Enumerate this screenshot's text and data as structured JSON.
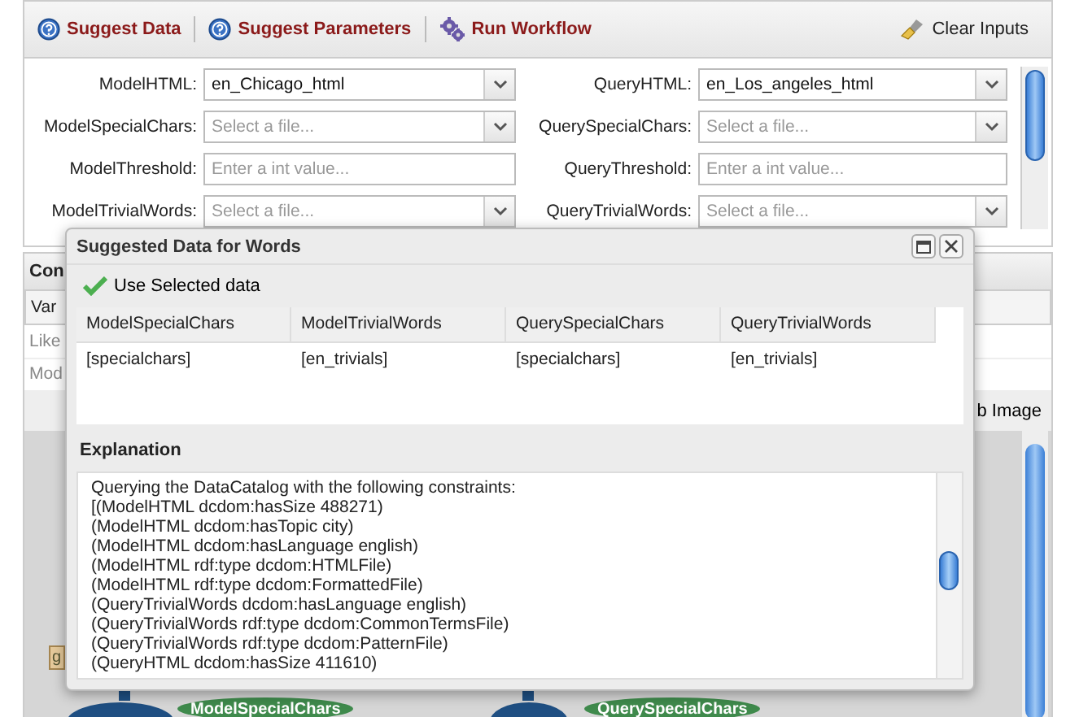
{
  "toolbar": {
    "buttons": [
      {
        "label": "Suggest Data",
        "kind": "help"
      },
      {
        "label": "Suggest Parameters",
        "kind": "help"
      },
      {
        "label": "Run Workflow",
        "kind": "gears"
      }
    ],
    "clear": "Clear Inputs"
  },
  "form": {
    "fields": [
      {
        "label": "ModelHTML:",
        "kind": "select",
        "value": "en_Chicago_html"
      },
      {
        "label": "QueryHTML:",
        "kind": "select",
        "value": "en_Los_angeles_html"
      },
      {
        "label": "ModelSpecialChars:",
        "kind": "select",
        "placeholder": "Select a file..."
      },
      {
        "label": "QuerySpecialChars:",
        "kind": "select",
        "placeholder": "Select a file..."
      },
      {
        "label": "ModelThreshold:",
        "kind": "text",
        "placeholder": "Enter a int value..."
      },
      {
        "label": "QueryThreshold:",
        "kind": "text",
        "placeholder": "Enter a int value..."
      },
      {
        "label": "ModelTrivialWords:",
        "kind": "select",
        "placeholder": "Select a file..."
      },
      {
        "label": "QueryTrivialWords:",
        "kind": "select",
        "placeholder": "Select a file..."
      }
    ]
  },
  "constraints_panel": {
    "title": "Con",
    "column": "Var",
    "rows": [
      "Like",
      "Mod"
    ]
  },
  "graph": {
    "button": "b Image",
    "label_fragment": "g",
    "nodes": [
      {
        "label": "ModelSpecialChars",
        "kind": "data"
      },
      {
        "label": "QuerySpecialChars",
        "kind": "data"
      }
    ]
  },
  "dialog": {
    "title": "Suggested Data for Words",
    "action": "Use Selected data",
    "columns": [
      "ModelSpecialChars",
      "ModelTrivialWords",
      "QuerySpecialChars",
      "QueryTrivialWords"
    ],
    "rows": [
      [
        "[specialchars]",
        "[en_trivials]",
        "[specialchars]",
        "[en_trivials]"
      ]
    ],
    "explanation_title": "Explanation",
    "explanation": [
      "Querying the DataCatalog with the following constraints:",
      "[(ModelHTML dcdom:hasSize 488271)",
      "(ModelHTML dcdom:hasTopic city)",
      "(ModelHTML dcdom:hasLanguage english)",
      "(ModelHTML rdf:type dcdom:HTMLFile)",
      "(ModelHTML rdf:type dcdom:FormattedFile)",
      "(QueryTrivialWords dcdom:hasLanguage english)",
      "(QueryTrivialWords rdf:type dcdom:CommonTermsFile)",
      "(QueryTrivialWords rdf:type dcdom:PatternFile)",
      "(QueryHTML dcdom:hasSize 411610)"
    ]
  }
}
